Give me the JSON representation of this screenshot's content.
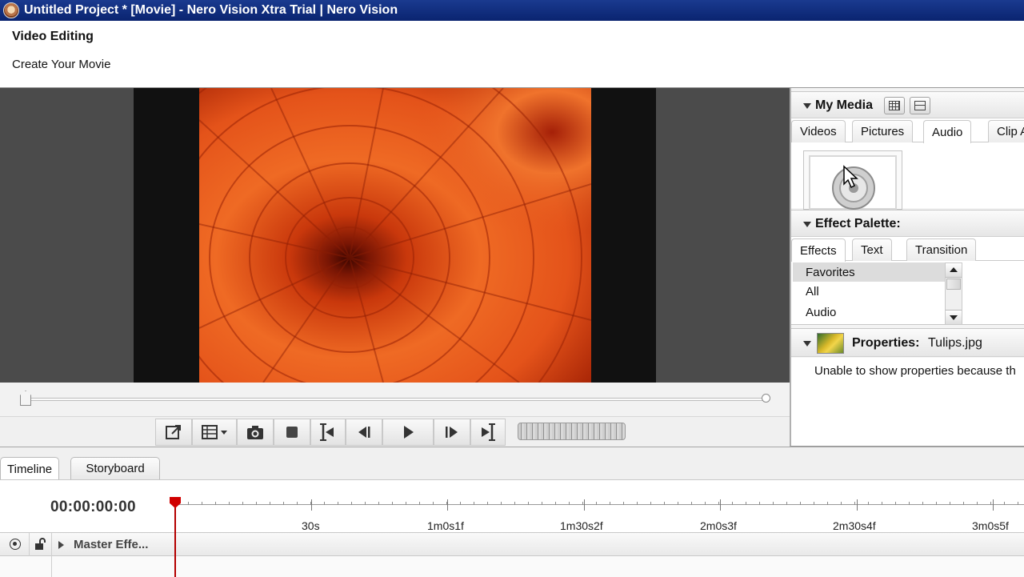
{
  "window": {
    "title": "Untitled Project * [Movie] - Nero Vision Xtra Trial | Nero Vision"
  },
  "header": {
    "title": "Video Editing",
    "subtitle": "Create Your Movie"
  },
  "my_media": {
    "title": "My Media",
    "tabs": [
      "Videos",
      "Pictures",
      "Audio",
      "Clip A"
    ],
    "active_tab": "Audio"
  },
  "effect_palette": {
    "title": "Effect Palette:",
    "tabs": [
      "Effects",
      "Text",
      "Transition"
    ],
    "active_tab": "Effects",
    "items": [
      "Favorites",
      "All",
      "Audio"
    ],
    "selected_item": "Favorites"
  },
  "properties": {
    "title": "Properties:",
    "filename": "Tulips.jpg",
    "message": "Unable to show properties because th"
  },
  "timeline": {
    "tabs": [
      "Timeline",
      "Storyboard"
    ],
    "active_tab": "Timeline",
    "timecode": "00:00:00:00",
    "ruler_labels": [
      "30s",
      "1m0s1f",
      "1m30s2f",
      "2m0s3f",
      "2m30s4f",
      "3m0s5f"
    ],
    "track_label": "Master Effe..."
  },
  "colors": {
    "titlebar": "#0a2470",
    "playhead": "#d00000",
    "preview_bg": "#4b4b4b"
  },
  "icons": {
    "transport": [
      "fullscreen-icon",
      "display-mode-icon",
      "snapshot-icon",
      "stop-icon",
      "go-to-start-icon",
      "previous-frame-icon",
      "play-icon",
      "next-frame-icon",
      "go-to-end-icon",
      "jog-wheel"
    ]
  }
}
